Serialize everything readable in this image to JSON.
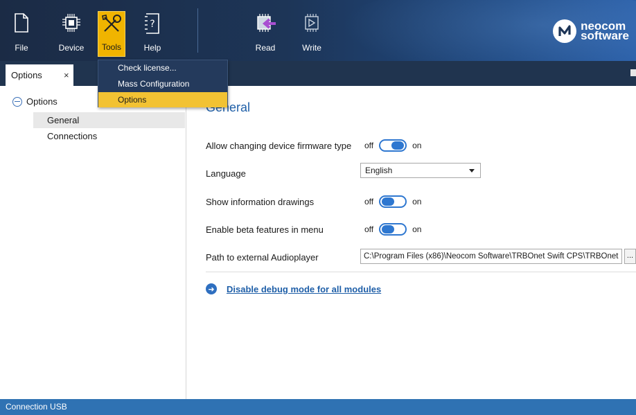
{
  "toolbar": {
    "file": "File",
    "device": "Device",
    "tools": "Tools",
    "help": "Help",
    "read": "Read",
    "write": "Write"
  },
  "logo": {
    "line1": "neocom",
    "line2": "software"
  },
  "tabs": [
    {
      "label": "Options",
      "close": "×"
    }
  ],
  "tools_menu": {
    "items": [
      "Check license...",
      "Mass Configuration",
      "Options"
    ],
    "selected": "Options"
  },
  "tree": {
    "root": "Options",
    "items": [
      "General",
      "Connections"
    ],
    "selected": "General"
  },
  "general": {
    "title": "General",
    "firmware": {
      "label": "Allow changing device firmware type",
      "off": "off",
      "on": "on",
      "state": "on"
    },
    "language": {
      "label": "Language",
      "value": "English"
    },
    "drawings": {
      "label": "Show information drawings",
      "off": "off",
      "on": "on",
      "state": "off"
    },
    "beta": {
      "label": "Enable beta features in menu",
      "off": "off",
      "on": "on",
      "state": "off"
    },
    "audioplayer": {
      "label": "Path to external Audioplayer",
      "value": "C:\\Program Files (x86)\\Neocom Software\\TRBOnet Swift CPS\\TRBOnet",
      "browse": "..."
    },
    "debug_link": "Disable debug mode for all modules"
  },
  "status": {
    "text": "Connection  USB"
  },
  "colors": {
    "accent": "#2e77d0",
    "status_bar": "#2f72b3",
    "tools_active": "#f0b400",
    "menu_selected": "#f2c233"
  }
}
